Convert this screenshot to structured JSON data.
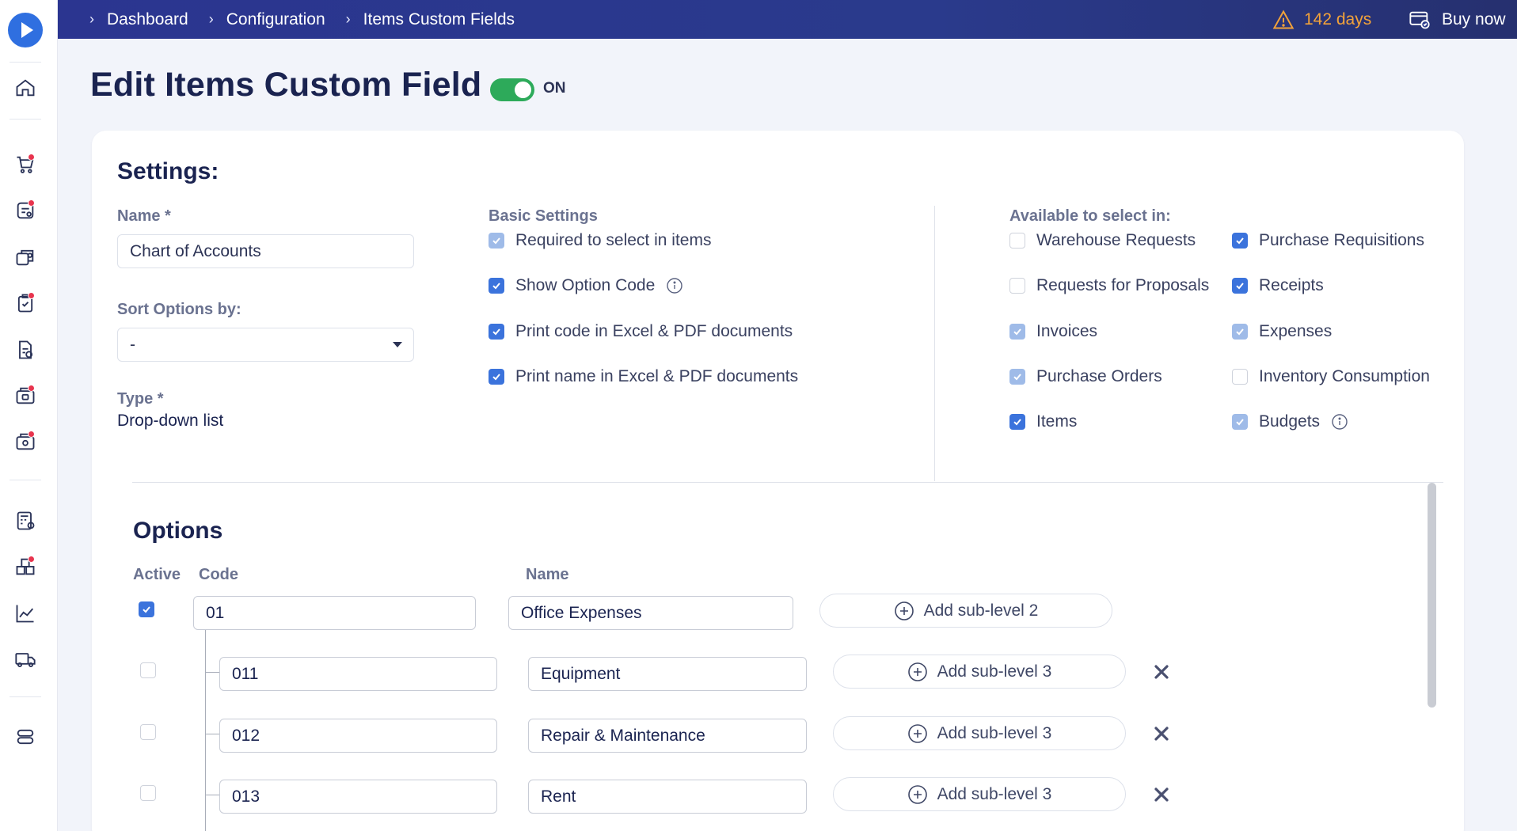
{
  "breadcrumbs": [
    {
      "label": "Dashboard"
    },
    {
      "label": "Configuration"
    },
    {
      "label": "Items Custom Fields"
    }
  ],
  "topbar": {
    "trial_label": "142 days",
    "buy_label": "Buy now"
  },
  "page": {
    "title": "Edit Items Custom Field",
    "toggle_label": "ON",
    "toggle_on": true
  },
  "sidebar": {
    "icons": [
      "logo-icon",
      "home-icon",
      "cart-icon",
      "requests-icon",
      "proposals-icon",
      "approvals-icon",
      "documents-icon",
      "invoices-icon",
      "payments-icon",
      "budget-icon",
      "inventory-icon",
      "reports-icon",
      "delivery-icon",
      "settings-icon"
    ]
  },
  "settings": {
    "heading": "Settings:",
    "name_label": "Name *",
    "name_value": "Chart of Accounts",
    "sort_label": "Sort Options by:",
    "sort_value": "-",
    "type_label": "Type *",
    "type_value": "Drop-down list",
    "basic_heading": "Basic Settings",
    "basic": [
      {
        "label": "Required to select in items",
        "state": "dim"
      },
      {
        "label": "Show Option Code",
        "state": "on",
        "info": true
      },
      {
        "label": "Print code in Excel & PDF documents",
        "state": "on"
      },
      {
        "label": "Print name in Excel & PDF documents",
        "state": "on"
      }
    ],
    "available_heading": "Available to select in:",
    "available_left": [
      {
        "label": "Warehouse Requests",
        "state": "off"
      },
      {
        "label": "Requests for Proposals",
        "state": "off"
      },
      {
        "label": "Invoices",
        "state": "dim"
      },
      {
        "label": "Purchase Orders",
        "state": "dim"
      },
      {
        "label": "Items",
        "state": "on"
      }
    ],
    "available_right": [
      {
        "label": "Purchase Requisitions",
        "state": "on"
      },
      {
        "label": "Receipts",
        "state": "on"
      },
      {
        "label": "Expenses",
        "state": "dim"
      },
      {
        "label": "Inventory Consumption",
        "state": "off"
      },
      {
        "label": "Budgets",
        "state": "dim",
        "info": true
      }
    ]
  },
  "options": {
    "heading": "Options",
    "col_active": "Active",
    "col_code": "Code",
    "col_name": "Name",
    "root": {
      "active": true,
      "code": "01",
      "name": "Office Expenses",
      "button": "Add sub-level 2"
    },
    "children": [
      {
        "active": false,
        "code": "011",
        "name": "Equipment",
        "button": "Add sub-level 3"
      },
      {
        "active": false,
        "code": "012",
        "name": "Repair & Maintenance",
        "button": "Add sub-level 3"
      },
      {
        "active": false,
        "code": "013",
        "name": "Rent",
        "button": "Add sub-level 3"
      }
    ]
  },
  "colors": {
    "topbar": "#2b3590",
    "accent": "#3b73dc",
    "toggle_on": "#2daa5a",
    "warning": "#f2a23a",
    "badge": "#e8344e"
  }
}
